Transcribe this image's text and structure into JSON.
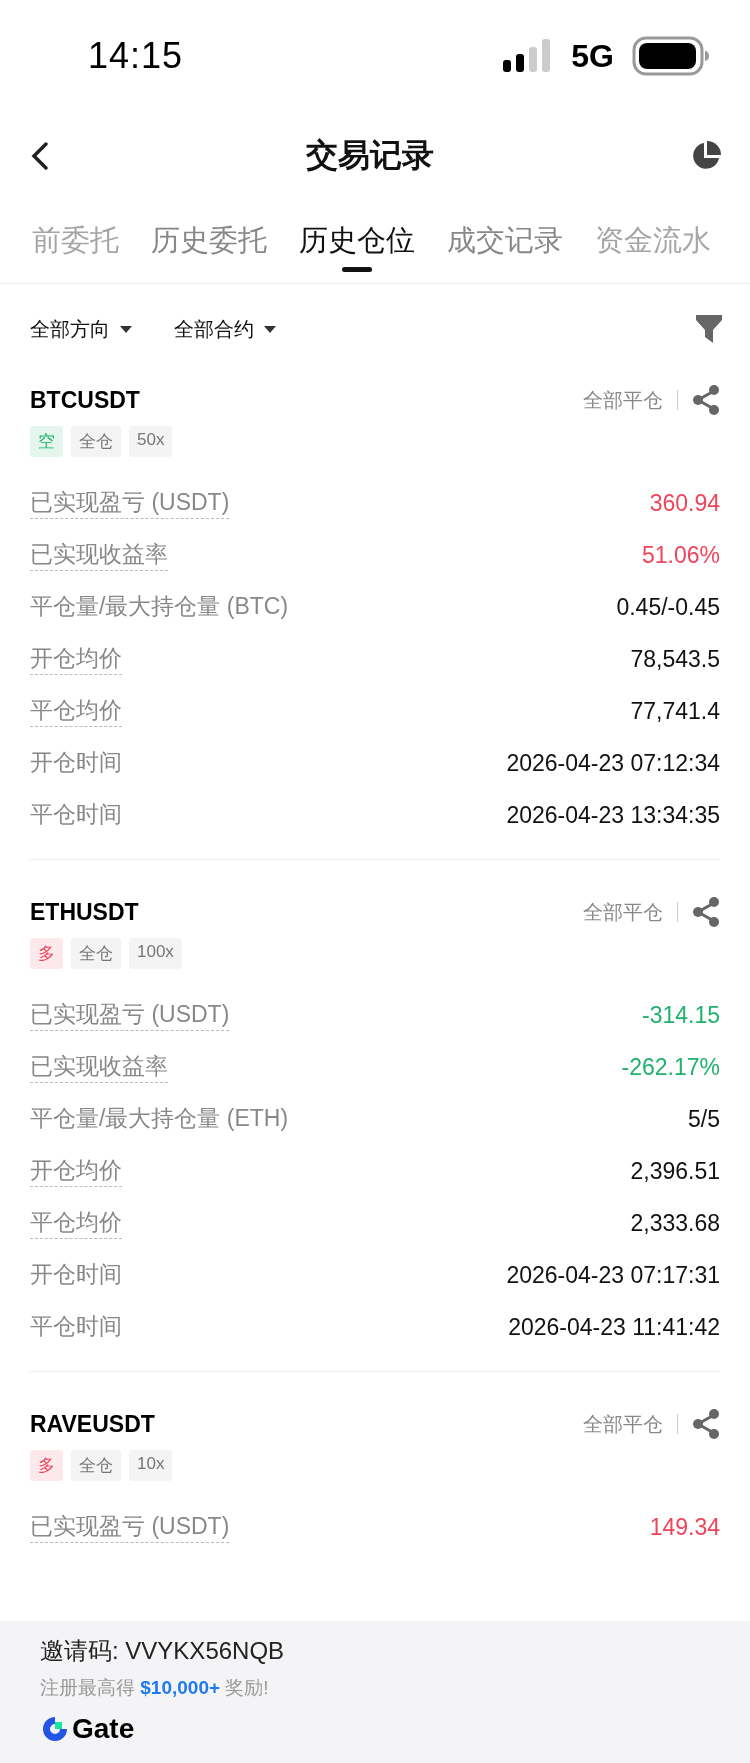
{
  "status_bar": {
    "time": "14:15",
    "network": "5G"
  },
  "nav": {
    "title": "交易记录"
  },
  "tabs": [
    {
      "label": "前委托",
      "selected": false
    },
    {
      "label": "历史委托",
      "selected": false
    },
    {
      "label": "历史仓位",
      "selected": true
    },
    {
      "label": "成交记录",
      "selected": false
    },
    {
      "label": "资金流水",
      "selected": false
    }
  ],
  "filters": [
    {
      "label": "全部方向"
    },
    {
      "label": "全部合约"
    }
  ],
  "positions": [
    {
      "symbol": "BTCUSDT",
      "close_all": "全部平仓",
      "tags": [
        {
          "text": "空",
          "kind": "side",
          "color": "#20b26c"
        },
        {
          "text": "全仓",
          "kind": "plain"
        },
        {
          "text": "50x",
          "kind": "plain"
        }
      ],
      "rows": [
        {
          "label": "已实现盈亏 (USDT)",
          "value": "360.94",
          "dotted": true,
          "color": "#f0445a"
        },
        {
          "label": "已实现收益率",
          "value": "51.06%",
          "dotted": true,
          "color": "#f0445a"
        },
        {
          "label": "平仓量/最大持仓量 (BTC)",
          "value": "0.45/-0.45",
          "dotted": false,
          "color": "#111111"
        },
        {
          "label": "开仓均价",
          "value": "78,543.5",
          "dotted": true,
          "color": "#111111"
        },
        {
          "label": "平仓均价",
          "value": "77,741.4",
          "dotted": true,
          "color": "#111111"
        },
        {
          "label": "开仓时间",
          "value": "2026-04-23 07:12:34",
          "dotted": false,
          "color": "#111111"
        },
        {
          "label": "平仓时间",
          "value": "2026-04-23 13:34:35",
          "dotted": false,
          "color": "#111111"
        }
      ]
    },
    {
      "symbol": "ETHUSDT",
      "close_all": "全部平仓",
      "tags": [
        {
          "text": "多",
          "kind": "side",
          "color": "#f0445a"
        },
        {
          "text": "全仓",
          "kind": "plain"
        },
        {
          "text": "100x",
          "kind": "plain"
        }
      ],
      "rows": [
        {
          "label": "已实现盈亏 (USDT)",
          "value": "-314.15",
          "dotted": true,
          "color": "#20b26c"
        },
        {
          "label": "已实现收益率",
          "value": "-262.17%",
          "dotted": true,
          "color": "#20b26c"
        },
        {
          "label": "平仓量/最大持仓量 (ETH)",
          "value": "5/5",
          "dotted": false,
          "color": "#111111"
        },
        {
          "label": "开仓均价",
          "value": "2,396.51",
          "dotted": true,
          "color": "#111111"
        },
        {
          "label": "平仓均价",
          "value": "2,333.68",
          "dotted": true,
          "color": "#111111"
        },
        {
          "label": "开仓时间",
          "value": "2026-04-23 07:17:31",
          "dotted": false,
          "color": "#111111"
        },
        {
          "label": "平仓时间",
          "value": "2026-04-23 11:41:42",
          "dotted": false,
          "color": "#111111"
        }
      ]
    },
    {
      "symbol": "RAVEUSDT",
      "close_all": "全部平仓",
      "tags": [
        {
          "text": "多",
          "kind": "side",
          "color": "#f0445a"
        },
        {
          "text": "全仓",
          "kind": "plain"
        },
        {
          "text": "10x",
          "kind": "plain"
        }
      ],
      "rows": [
        {
          "label": "已实现盈亏 (USDT)",
          "value": "149.34",
          "dotted": true,
          "color": "#f0445a"
        }
      ]
    }
  ],
  "footer": {
    "invite": "邀请码: VVYKX56NQB",
    "promo": "注册最高得 **$10,000+** 奖励!",
    "brand": "Gate"
  }
}
